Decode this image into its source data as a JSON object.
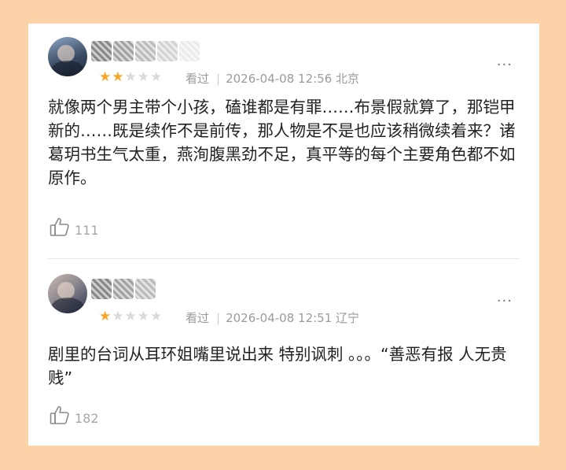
{
  "reviews": [
    {
      "rating": 2,
      "max_rating": 5,
      "watched_label": "看过",
      "timestamp": "2026-04-08 12:56",
      "location": "北京",
      "content": "就像两个男主带个小孩，磕谁都是有罪……布景假就算了，那铠甲新的……既是续作不是前传，那人物是不是也应该稍微续着来？诸葛玥书生气太重，燕洵腹黑劲不足，真平等的每个主要角色都不如原作。",
      "like_count": "111",
      "more_icon": "···"
    },
    {
      "rating": 1,
      "max_rating": 5,
      "watched_label": "看过",
      "timestamp": "2026-04-08 12:51",
      "location": "辽宁",
      "content": "剧里的台词从耳环姐嘴里说出来 特别讽刺 。。。“善恶有报 人无贵贱”",
      "like_count": "182",
      "more_icon": "···"
    }
  ],
  "colors": {
    "background": "#FCD3A8",
    "star_on": "#F6A623",
    "star_off": "#DADADA",
    "meta_text": "#9b9b9b"
  }
}
